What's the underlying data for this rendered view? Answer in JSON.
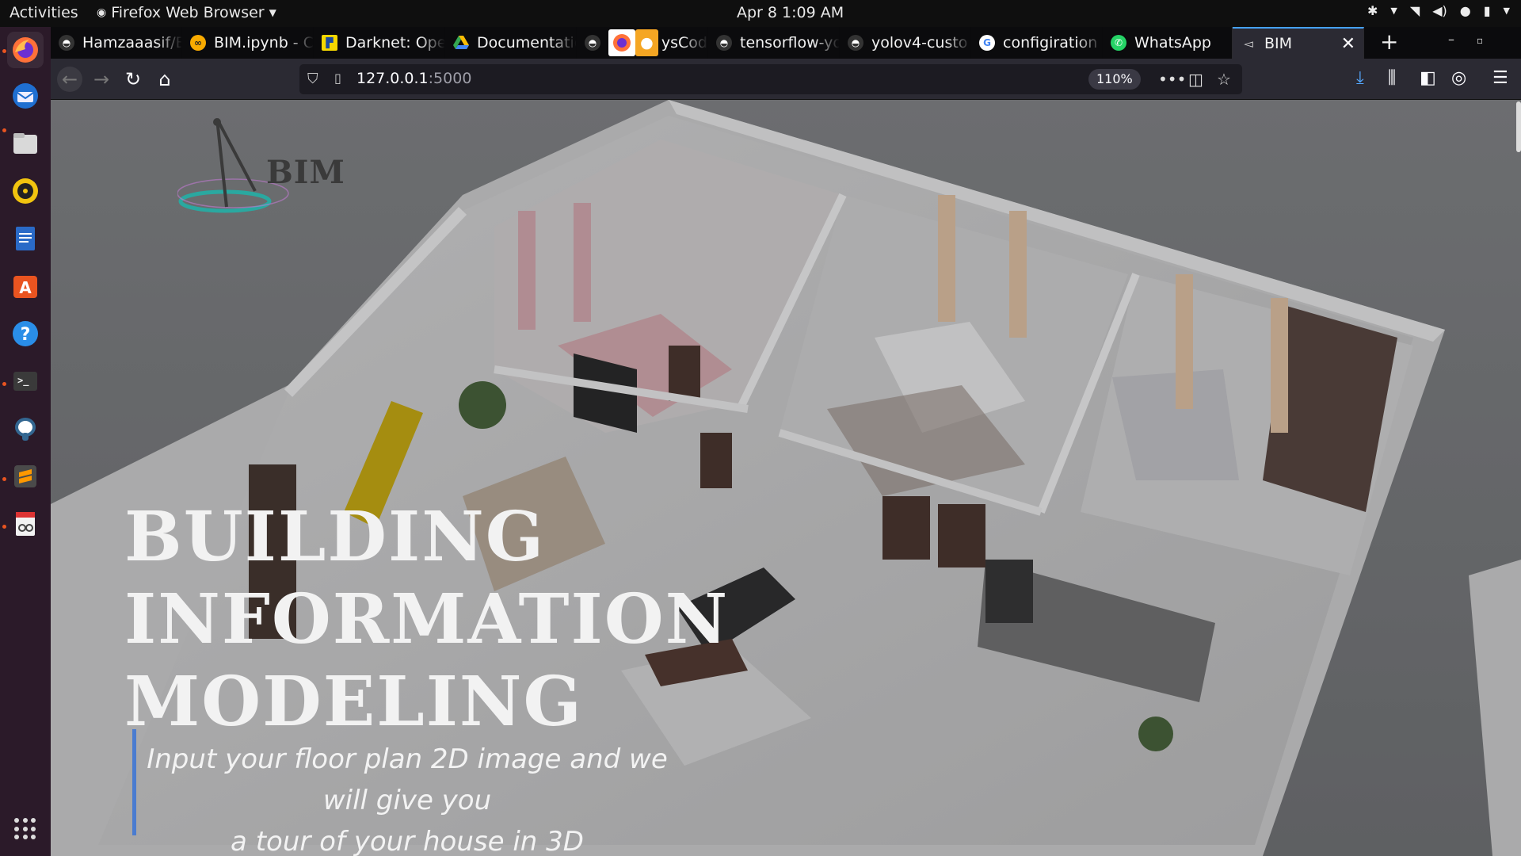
{
  "system_bar": {
    "activities": "Activities",
    "app_name": "Firefox Web Browser",
    "clock": "Apr 8  1:09 AM"
  },
  "dock": {
    "apps": [
      "firefox-icon",
      "thunderbird-icon",
      "files-icon",
      "rhythmbox-icon",
      "writer-icon",
      "software-center-icon",
      "help-icon",
      "terminal-icon",
      "pgadmin-icon",
      "sublime-text-icon",
      "document-viewer-icon"
    ]
  },
  "browser": {
    "tabs": [
      {
        "label": "Hamzaaasif/B",
        "icon": "github-icon"
      },
      {
        "label": "BIM.ipynb - Co",
        "icon": "colab-icon"
      },
      {
        "label": "Darknet: Ope",
        "icon": "pjreddie-icon"
      },
      {
        "label": "Documentatio",
        "icon": "google-drive-icon"
      },
      {
        "label": "ysCod",
        "icon": "github-icon"
      },
      {
        "label": "tensorflow-yo",
        "icon": "github-icon"
      },
      {
        "label": "yolov4-custo",
        "icon": "github-icon"
      },
      {
        "label": "configiration",
        "icon": "google-icon"
      },
      {
        "label": "WhatsApp",
        "icon": "whatsapp-icon"
      },
      {
        "label": "BIM",
        "icon": "site-icon",
        "active": true
      }
    ],
    "url_host": "127.0.0.1",
    "url_port": ":5000",
    "zoom": "110%"
  },
  "page": {
    "logo_text": "BIM",
    "hero_title_lines": [
      "BUILDING",
      "INFORMATION",
      "MODELING"
    ],
    "hero_subtitle_lines": [
      "Input your floor plan 2D image and we will give you",
      "a tour of your house in 3D"
    ]
  },
  "colors": {
    "accent_blue": "#4a7cd0",
    "ubuntu_orange": "#e95420",
    "dock_bg": "#2b1a29"
  }
}
